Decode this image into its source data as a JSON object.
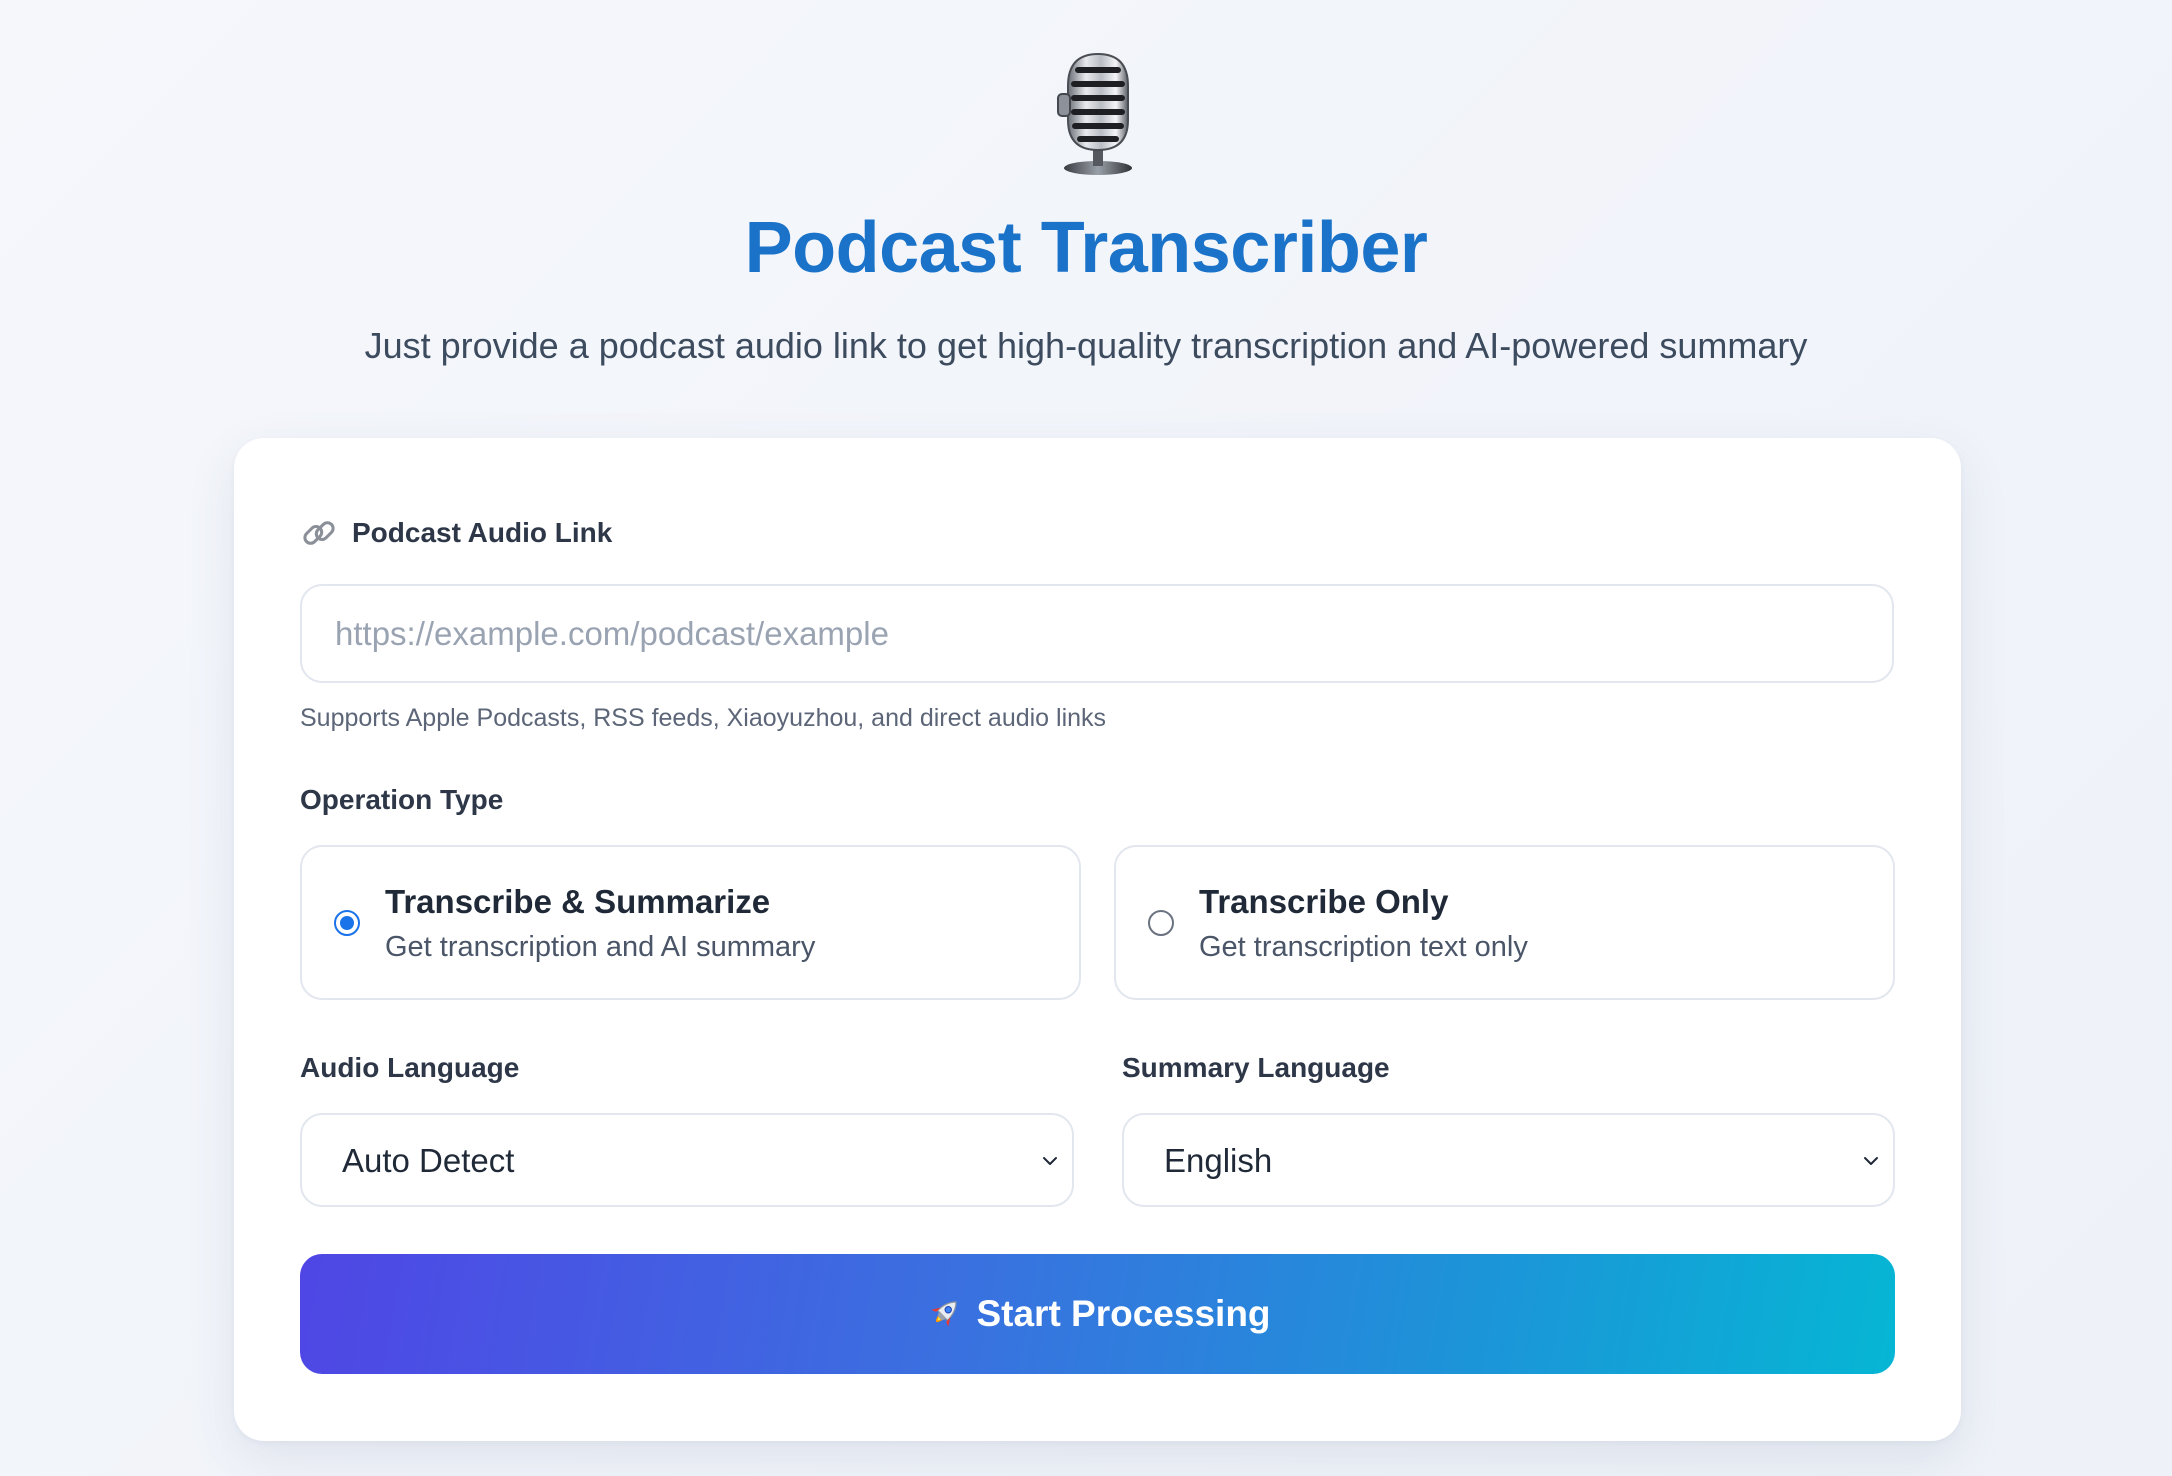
{
  "header": {
    "icon": "studio-microphone-icon",
    "title": "Podcast Transcriber",
    "subtitle": "Just provide a podcast audio link to get high-quality transcription and AI-powered summary"
  },
  "form": {
    "link": {
      "icon": "link-icon",
      "label": "Podcast Audio Link",
      "placeholder": "https://example.com/podcast/example",
      "value": "",
      "help": "Supports Apple Podcasts, RSS feeds, Xiaoyuzhou, and direct audio links"
    },
    "operation": {
      "label": "Operation Type",
      "options": [
        {
          "title": "Transcribe & Summarize",
          "description": "Get transcription and AI summary",
          "selected": true
        },
        {
          "title": "Transcribe Only",
          "description": "Get transcription text only",
          "selected": false
        }
      ]
    },
    "audio_language": {
      "label": "Audio Language",
      "selected": "Auto Detect"
    },
    "summary_language": {
      "label": "Summary Language",
      "selected": "English"
    },
    "submit": {
      "icon": "rocket-icon",
      "label": "Start Processing"
    }
  },
  "colors": {
    "title": "#1a73c9",
    "accent": "#1a73e8",
    "button_gradient_start": "#4f46e5",
    "button_gradient_end": "#06b6d4"
  }
}
